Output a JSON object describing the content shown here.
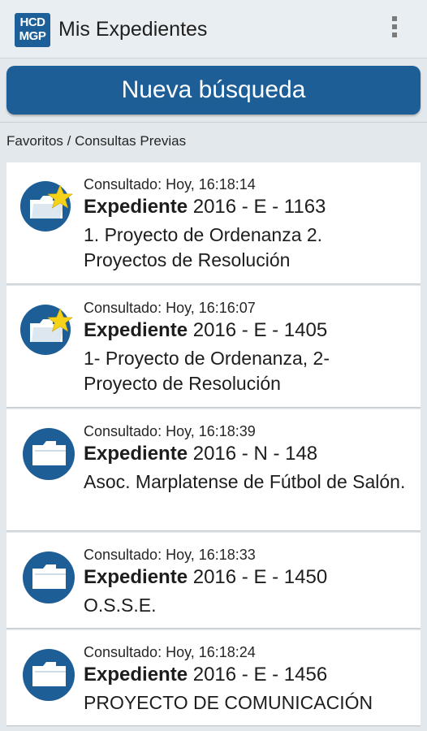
{
  "appbar": {
    "logo_line1": "HCD",
    "logo_line2": "MGP",
    "title": "Mis Expedientes",
    "menu_icon": "overflow-menu-icon"
  },
  "search_button": {
    "label": "Nueva búsqueda"
  },
  "section": {
    "label": "Favoritos / Consultas Previas"
  },
  "colors": {
    "primary": "#1e5e97",
    "star": "#f6d21b",
    "background": "#e3e8ec",
    "card": "#ffffff"
  },
  "cards": [
    {
      "favorite": true,
      "icon": "folder-star-icon",
      "consulted": "Consultado: Hoy, 16:18:14",
      "prefix": "Expediente",
      "number": "2016 - E - 1163",
      "subject": "1. Proyecto de Ordenanza 2. Proyectos de Resolución"
    },
    {
      "favorite": true,
      "icon": "folder-star-icon",
      "consulted": "Consultado: Hoy, 16:16:07",
      "prefix": "Expediente",
      "number": "2016 - E - 1405",
      "subject": "1- Proyecto de Ordenanza, 2- Proyecto de Resolución"
    },
    {
      "favorite": false,
      "icon": "folder-icon",
      "consulted": "Consultado: Hoy, 16:18:39",
      "prefix": "Expediente",
      "number": "2016 - N - 148",
      "subject": "Asoc. Marplatense de Fútbol de Salón."
    },
    {
      "favorite": false,
      "icon": "folder-icon",
      "consulted": "Consultado: Hoy, 16:18:33",
      "prefix": "Expediente",
      "number": "2016 - E - 1450",
      "subject": "O.S.S.E."
    },
    {
      "favorite": false,
      "icon": "folder-icon",
      "consulted": "Consultado: Hoy, 16:18:24",
      "prefix": "Expediente",
      "number": "2016 - E - 1456",
      "subject": "PROYECTO DE COMUNICACIÓN"
    }
  ]
}
